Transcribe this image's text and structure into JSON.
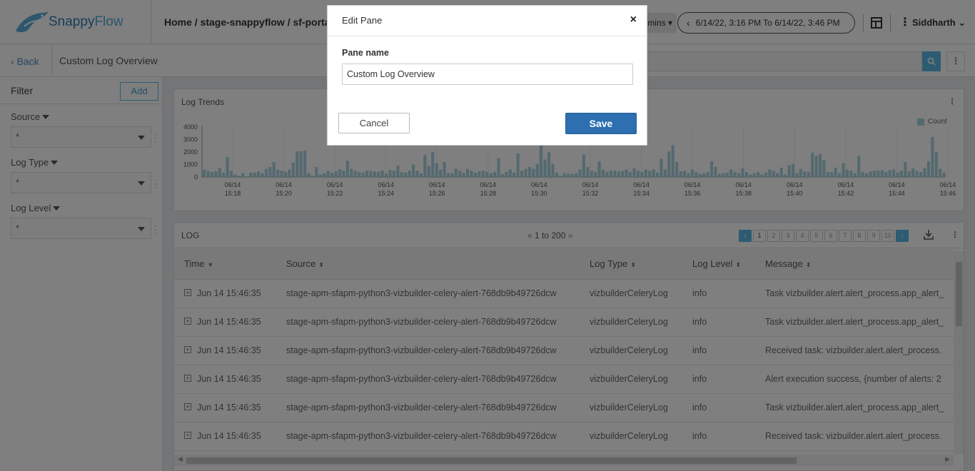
{
  "header": {
    "logo_text_a": "Snappy",
    "logo_text_b": "Flow",
    "breadcrumb": "Home / stage-snappyflow / sf-porta",
    "range_label": "mins",
    "time_range": "6/14/22, 3:16 PM To 6/14/22, 3:46 PM",
    "user": "Siddharth"
  },
  "subbar": {
    "back_label": "Back",
    "page_title": "Custom Log Overview"
  },
  "filter": {
    "title": "Filter",
    "add_label": "Add",
    "fields": [
      {
        "label": "Source",
        "value": "*"
      },
      {
        "label": "Log Type",
        "value": "*"
      },
      {
        "label": "Log Level",
        "value": "*"
      }
    ]
  },
  "trends": {
    "title": "Log Trends",
    "legend": "Count"
  },
  "chart_data": {
    "type": "bar",
    "title": "Log Trends",
    "ylim": [
      0,
      4000
    ],
    "yticks": [
      0,
      1000,
      2000,
      3000,
      4000
    ],
    "x_tick_dates": [
      "06/14",
      "06/14",
      "06/14",
      "06/14",
      "06/14",
      "06/14",
      "06/14",
      "06/14",
      "06/14",
      "06/14",
      "06/14",
      "06/14",
      "06/14",
      "06/14",
      "06/14"
    ],
    "x_tick_times": [
      "15:18",
      "15:20",
      "15:22",
      "15:24",
      "15:26",
      "15:28",
      "15:30",
      "15:32",
      "15:34",
      "15:36",
      "15:38",
      "15:40",
      "15:42",
      "15:44",
      "15:46"
    ],
    "series": [
      {
        "name": "Count",
        "color": "#a9d3e0",
        "values": [
          600,
          500,
          400,
          450,
          700,
          350,
          1600,
          500,
          200,
          100,
          300,
          50,
          350,
          350,
          450,
          300,
          650,
          800,
          1200,
          600,
          500,
          400,
          600,
          1150,
          2050,
          2050,
          2100,
          300,
          100,
          800,
          200,
          300,
          500,
          350,
          450,
          600,
          500,
          1300,
          650,
          500,
          400,
          350,
          500,
          500,
          450,
          400,
          500,
          300,
          550,
          500,
          900,
          400,
          350,
          500,
          1000,
          500,
          300,
          1750,
          900,
          2000,
          1100,
          600,
          1200,
          300,
          300,
          650,
          500,
          350,
          650,
          500,
          350,
          450,
          500,
          400,
          300,
          400,
          1500,
          250,
          400,
          600,
          350,
          1900,
          500,
          650,
          800,
          650,
          1050,
          2600,
          1400,
          2000,
          1050,
          350,
          100,
          300,
          250,
          250,
          300,
          600,
          1800,
          800,
          500,
          400,
          1250,
          600,
          400,
          500,
          500,
          450,
          500,
          600,
          400,
          700,
          500,
          400,
          600,
          500,
          600,
          350,
          1450,
          600,
          2050,
          2550,
          1200,
          450,
          500,
          300,
          600,
          400,
          250,
          300,
          400,
          1250,
          800,
          250,
          300,
          350,
          600,
          400,
          300,
          700,
          400,
          200,
          300,
          400,
          200,
          350,
          600,
          500,
          300,
          750,
          200,
          950,
          1050,
          300,
          650,
          450,
          400,
          1950,
          1700,
          1850,
          1350,
          400,
          400,
          750,
          300,
          1100,
          600,
          500,
          300,
          1700,
          400,
          300,
          450,
          500,
          500,
          550,
          400,
          550,
          600,
          350,
          500,
          1200,
          450,
          700,
          500,
          400,
          700,
          1250,
          3200,
          2000,
          650,
          350
        ]
      }
    ]
  },
  "log": {
    "title": "LOG",
    "page_range": "1 to 200",
    "pages": [
      "1",
      "2",
      "3",
      "4",
      "5",
      "6",
      "7",
      "8",
      "9",
      "10"
    ],
    "columns": [
      "Time",
      "Source",
      "Log Type",
      "Log Level",
      "Message"
    ],
    "rows": [
      {
        "time": "Jun 14 15:46:35",
        "source": "stage-apm-sfapm-python3-vizbuilder-celery-alert-768db9b49726dcw",
        "type": "vizbuilderCeleryLog",
        "level": "info",
        "message": "Task vizbuilder.alert.alert_process.app_alert_"
      },
      {
        "time": "Jun 14 15:46:35",
        "source": "stage-apm-sfapm-python3-vizbuilder-celery-alert-768db9b49726dcw",
        "type": "vizbuilderCeleryLog",
        "level": "info",
        "message": "Task vizbuilder.alert.alert_process.app_alert_"
      },
      {
        "time": "Jun 14 15:46:35",
        "source": "stage-apm-sfapm-python3-vizbuilder-celery-alert-768db9b49726dcw",
        "type": "vizbuilderCeleryLog",
        "level": "info",
        "message": "Received task: vizbuilder.alert.alert_process."
      },
      {
        "time": "Jun 14 15:46:35",
        "source": "stage-apm-sfapm-python3-vizbuilder-celery-alert-768db9b49726dcw",
        "type": "vizbuilderCeleryLog",
        "level": "info",
        "message": "Alert execution success, {number of alerts: 2"
      },
      {
        "time": "Jun 14 15:46:35",
        "source": "stage-apm-sfapm-python3-vizbuilder-celery-alert-768db9b49726dcw",
        "type": "vizbuilderCeleryLog",
        "level": "info",
        "message": "Task vizbuilder.alert.alert_process.app_alert_"
      },
      {
        "time": "Jun 14 15:46:35",
        "source": "stage-apm-sfapm-python3-vizbuilder-celery-alert-768db9b49726dcw",
        "type": "vizbuilderCeleryLog",
        "level": "info",
        "message": "Received task: vizbuilder.alert.alert_process."
      }
    ]
  },
  "modal": {
    "title": "Edit Pane",
    "close": "×",
    "field_label": "Pane name",
    "field_value": "Custom Log Overview",
    "cancel_label": "Cancel",
    "save_label": "Save"
  }
}
